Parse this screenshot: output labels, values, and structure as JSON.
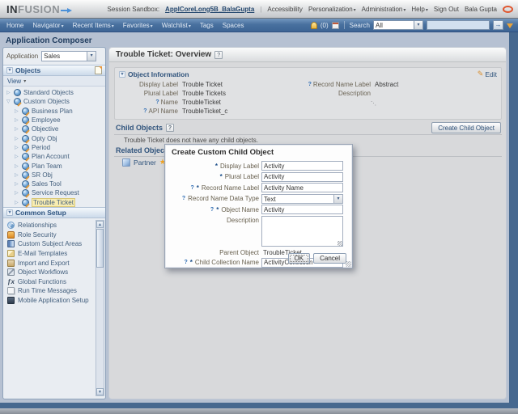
{
  "icons": {
    "required": "*",
    "help": "?",
    "caret_down": "▾",
    "tree_collapsed": "▷",
    "tree_expanded": "▽",
    "section_chevron": "▾",
    "star": "★",
    "pencil": "✎",
    "go_arrow": "→",
    "functions": "ƒx",
    "grip": "⋱",
    "scroll_up": "▲",
    "scroll_down": "▼"
  },
  "colors": {
    "navbar_blue": "#41699b",
    "frame_blue_gray": "#b6c1d2",
    "page_background": "#46688f",
    "selection_yellow": "#f8edb2",
    "header_navy": "#2f537c",
    "star_orange": "#f5a623",
    "required_blue": "#1c4f8a"
  },
  "topbar": {
    "logo_primary": "IN",
    "logo_secondary": "FUSION",
    "session_label": "Session Sandbox:",
    "session_value": "ApplCoreLong5B_BalaGupta",
    "links": [
      {
        "label": "Accessibility"
      },
      {
        "label": "Personalization"
      },
      {
        "label": "Administration"
      },
      {
        "label": "Help"
      },
      {
        "label": "Sign Out"
      }
    ],
    "user_name": "Bala Gupta"
  },
  "navbar": {
    "items": [
      {
        "label": "Home"
      },
      {
        "label": "Navigator"
      },
      {
        "label": "Recent Items"
      },
      {
        "label": "Favorites"
      },
      {
        "label": "Watchlist"
      },
      {
        "label": "Tags"
      },
      {
        "label": "Spaces"
      }
    ],
    "alerts_count": "(0)",
    "search_label": "Search",
    "search_scope": "All"
  },
  "sidebar": {
    "title": "Application Composer",
    "application_label": "Application",
    "application_value": "Sales",
    "objects_header": "Objects",
    "view_label": "View",
    "tree": [
      {
        "label": "Standard Objects"
      },
      {
        "label": "Custom Objects"
      },
      {
        "label": "Business Plan"
      },
      {
        "label": "Employee"
      },
      {
        "label": "Objective"
      },
      {
        "label": "Opty Obj"
      },
      {
        "label": "Period"
      },
      {
        "label": "Plan Account"
      },
      {
        "label": "Plan Team"
      },
      {
        "label": "SR Obj"
      },
      {
        "label": "Sales Tool"
      },
      {
        "label": "Service Request"
      },
      {
        "label": "Trouble Ticket"
      }
    ],
    "common_setup_header": "Common Setup",
    "common_setup": [
      {
        "label": "Relationships"
      },
      {
        "label": "Role Security"
      },
      {
        "label": "Custom Subject Areas"
      },
      {
        "label": "E-Mail Templates"
      },
      {
        "label": "Import and Export"
      },
      {
        "label": "Object Workflows"
      },
      {
        "label": "Global Functions"
      },
      {
        "label": "Run Time Messages"
      },
      {
        "label": "Mobile Application Setup"
      }
    ]
  },
  "main": {
    "title": "Trouble Ticket: Overview",
    "object_information": {
      "header": "Object Information",
      "edit_label": "Edit",
      "fields_left": [
        {
          "label": "Display Label",
          "value": "Trouble Ticket"
        },
        {
          "label": "Plural Label",
          "value": "Trouble Tickets"
        },
        {
          "label": "Name",
          "value": "TroubleTicket"
        },
        {
          "label": "API Name",
          "value": "TroubleTicket_c"
        }
      ],
      "fields_right": [
        {
          "label": "Record Name Label",
          "value": "Abstract"
        },
        {
          "label": "Description",
          "value": ""
        }
      ]
    },
    "child_objects": {
      "header": "Child Objects",
      "create_button": "Create Child Object",
      "empty_text": "Trouble Ticket does not have any child objects."
    },
    "related_objects": {
      "header": "Related Objects",
      "items": [
        {
          "label": "Partner"
        }
      ]
    }
  },
  "dialog": {
    "title": "Create Custom Child Object",
    "fields": [
      {
        "label": "Display Label",
        "value": "Activity"
      },
      {
        "label": "Plural Label",
        "value": "Activity"
      },
      {
        "label": "Record Name Label",
        "value": "Activity Name"
      },
      {
        "label": "Record Name Data Type",
        "value": "Text"
      },
      {
        "label": "Object Name",
        "value": "Activity"
      },
      {
        "label": "Description",
        "value": ""
      },
      {
        "label": "Parent Object",
        "value": "TroubleTicket"
      },
      {
        "label": "Child Collection Name",
        "value": "ActivityCollection"
      }
    ],
    "ok_label": "OK",
    "cancel_label": "Cancel"
  }
}
